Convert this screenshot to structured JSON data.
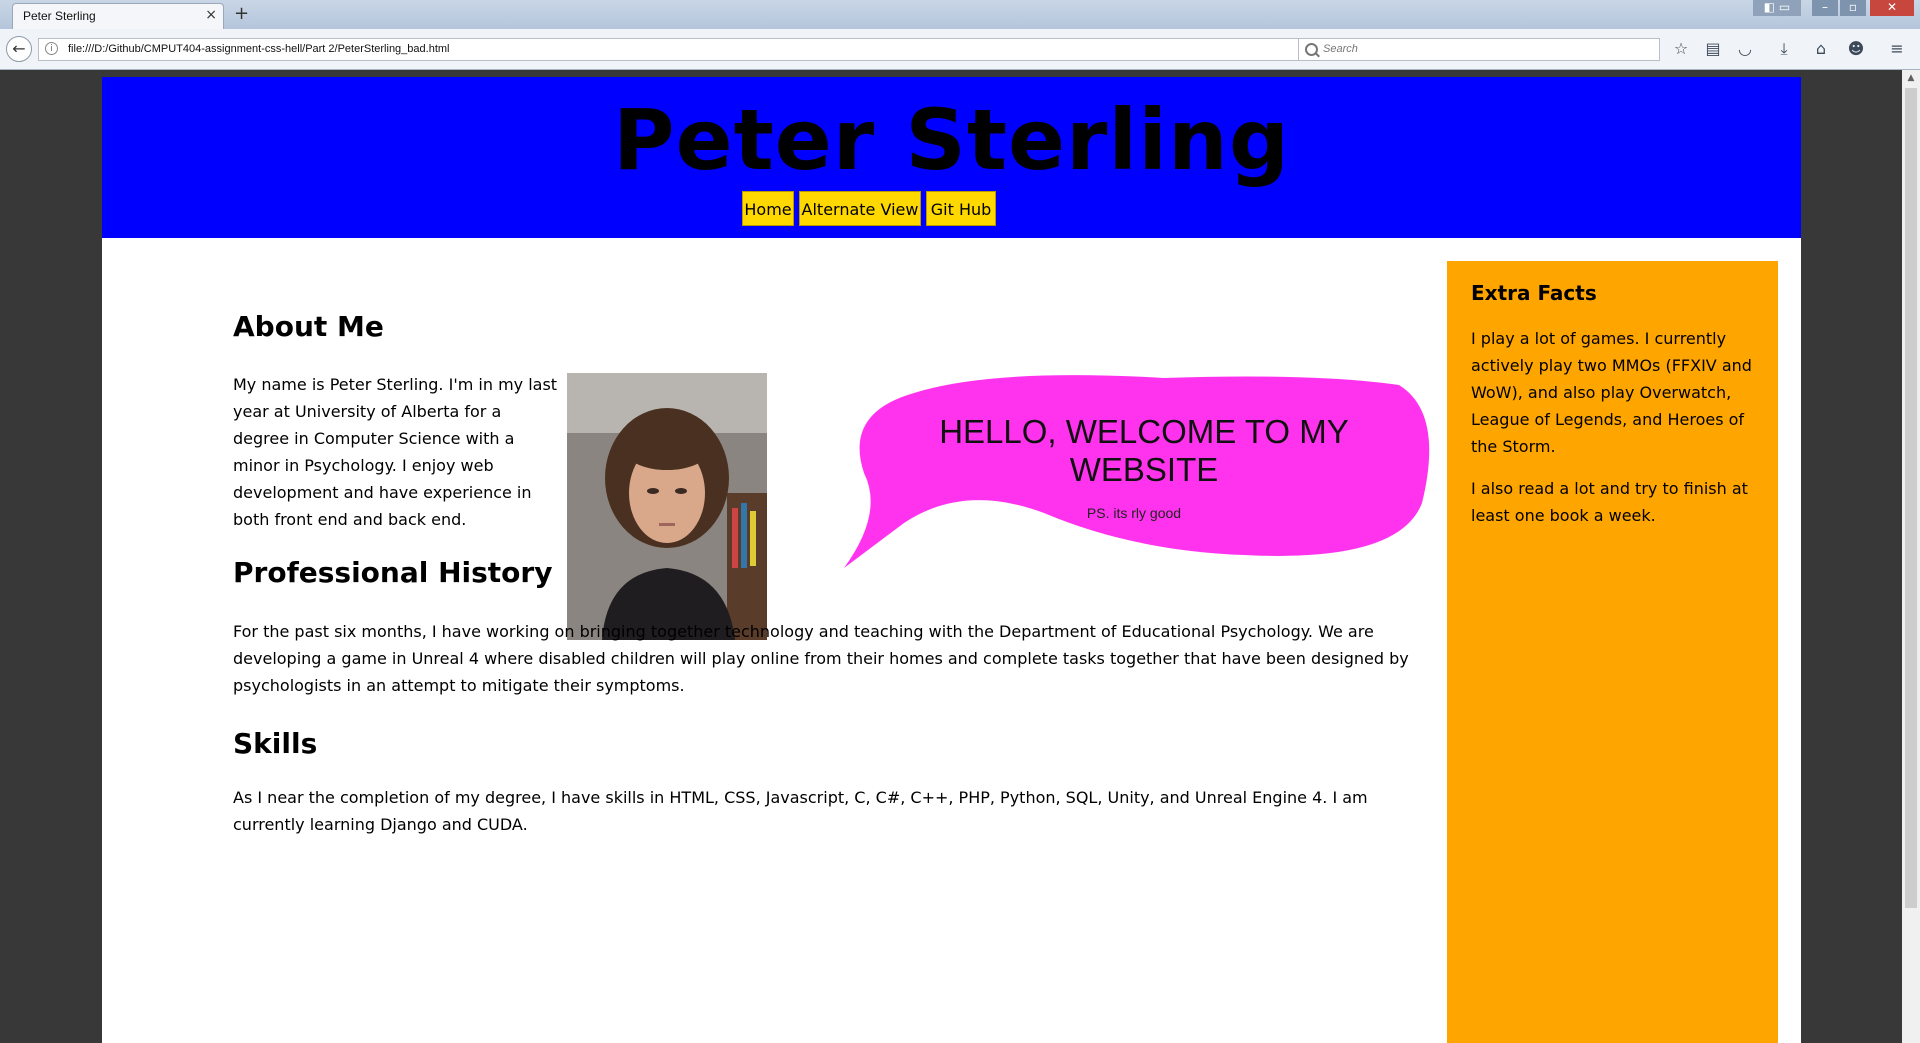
{
  "browser": {
    "tab_title": "Peter Sterling",
    "tab_close": "×",
    "new_tab": "+",
    "url": "file:///D:/Github/CMPUT404-assignment-css-hell/Part 2/PeterSterling_bad.html",
    "search_placeholder": "Search",
    "toolbar_icons": [
      "bookmark-star-icon",
      "reading-list-icon",
      "pocket-icon",
      "download-icon",
      "home-icon",
      "chat-icon",
      "menu-icon"
    ]
  },
  "site": {
    "title": "Peter Sterling",
    "nav": [
      {
        "label": "Home"
      },
      {
        "label": "Alternate View"
      },
      {
        "label": "Git Hub"
      }
    ]
  },
  "main": {
    "about_heading": "About Me",
    "about_text": "My name is Peter Sterling. I'm in my last year at University of Alberta for a degree in Computer Science with a minor in Psychology. I enjoy web development and have experience in both front end and back end.",
    "history_heading": "Professional History",
    "history_text": "For the past six months, I have working on bringing together technology and teaching with the Department of Educational Psychology. We are developing a game in Unreal 4 where disabled children will play online from their homes and complete tasks together that have been designed by psychologists in an attempt to mitigate their symptoms.",
    "skills_heading": "Skills",
    "skills_text": "As I near the completion of my degree, I have skills in HTML, CSS, Javascript, C, C#, C++, PHP, Python, SQL, Unity, and Unreal Engine 4. I am currently learning Django and CUDA.",
    "bubble_text": "HELLO, WELCOME TO MY WEBSITE",
    "bubble_sub": "PS. its rly good"
  },
  "aside": {
    "heading": "Extra Facts",
    "fact1": "I play a lot of games. I currently actively play two MMOs (FFXIV and WoW), and also play Overwatch, League of Legends, and Heroes of the Storm.",
    "fact2": "I also read a lot and try to finish at least one book a week."
  },
  "colors": {
    "header_bg": "#0000ff",
    "nav_bg": "#ffd800",
    "aside_bg": "#ffa500",
    "bubble_fill": "#ff33ee"
  }
}
